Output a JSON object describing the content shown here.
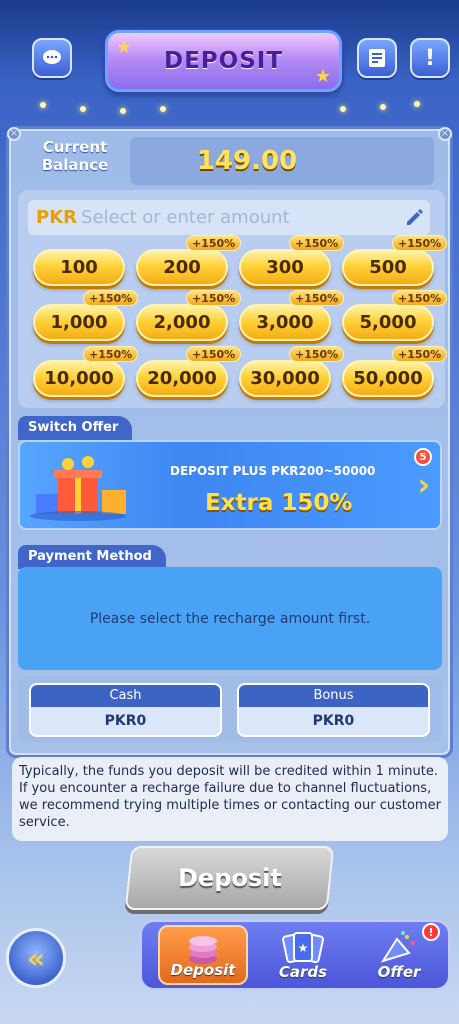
{
  "header": {
    "title": "DEPOSIT"
  },
  "balance": {
    "label": "Current Balance",
    "value": "149.00"
  },
  "amount_input": {
    "currency": "PKR",
    "placeholder": "Select or enter amount"
  },
  "amounts": [
    {
      "value": "100",
      "bonus": ""
    },
    {
      "value": "200",
      "bonus": "+150%"
    },
    {
      "value": "300",
      "bonus": "+150%"
    },
    {
      "value": "500",
      "bonus": "+150%"
    },
    {
      "value": "1,000",
      "bonus": "+150%"
    },
    {
      "value": "2,000",
      "bonus": "+150%"
    },
    {
      "value": "3,000",
      "bonus": "+150%"
    },
    {
      "value": "5,000",
      "bonus": "+150%"
    },
    {
      "value": "10,000",
      "bonus": "+150%"
    },
    {
      "value": "20,000",
      "bonus": "+150%"
    },
    {
      "value": "30,000",
      "bonus": "+150%"
    },
    {
      "value": "50,000",
      "bonus": "+150%"
    }
  ],
  "switch_offer": {
    "tab_label": "Switch Offer",
    "title": "DEPOSIT PLUS  PKR200~50000",
    "extra": "Extra 150%",
    "badge": "5"
  },
  "payment": {
    "tab_label": "Payment Method",
    "message": "Please select the recharge amount first."
  },
  "wallet": {
    "cash_label": "Cash",
    "cash_value": "PKR0",
    "bonus_label": "Bonus",
    "bonus_value": "PKR0"
  },
  "notice": "Typically, the funds you deposit will be credited within 1 minute. If you encounter a recharge failure due to channel fluctuations, we recommend trying multiple times or contacting our customer service.",
  "deposit_button": "Deposit",
  "nav": {
    "items": [
      {
        "label": "Deposit",
        "icon": "coins-icon",
        "active": true
      },
      {
        "label": "Cards",
        "icon": "cards-icon",
        "active": false
      },
      {
        "label": "Offer",
        "icon": "party-icon",
        "active": false,
        "badge": "!"
      }
    ]
  },
  "colors": {
    "accent_gold": "#ffd23a",
    "panel_blue": "#3f66c8",
    "title_purple": "#4b1d9a"
  }
}
